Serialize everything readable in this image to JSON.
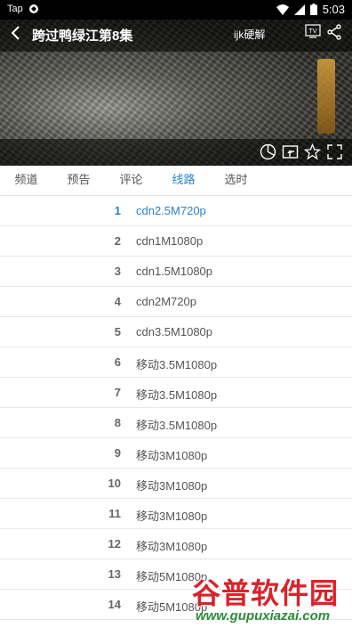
{
  "status_bar": {
    "carrier": "Tap",
    "time": "5:03"
  },
  "player": {
    "title": "跨过鸭绿江第8集",
    "decode_label": "ijk硬解",
    "tv_label": "TV"
  },
  "tabs": [
    {
      "label": "频道",
      "active": false
    },
    {
      "label": "预告",
      "active": false
    },
    {
      "label": "评论",
      "active": false
    },
    {
      "label": "线路",
      "active": true
    },
    {
      "label": "选时",
      "active": false
    }
  ],
  "routes": [
    {
      "index": "1",
      "name": "cdn2.5M720p",
      "selected": true
    },
    {
      "index": "2",
      "name": "cdn1M1080p"
    },
    {
      "index": "3",
      "name": "cdn1.5M1080p"
    },
    {
      "index": "4",
      "name": "cdn2M720p"
    },
    {
      "index": "5",
      "name": "cdn3.5M1080p"
    },
    {
      "index": "6",
      "name": "移动3.5M1080p"
    },
    {
      "index": "7",
      "name": "移动3.5M1080p"
    },
    {
      "index": "8",
      "name": "移动3.5M1080p"
    },
    {
      "index": "9",
      "name": "移动3M1080p"
    },
    {
      "index": "10",
      "name": "移动3M1080p"
    },
    {
      "index": "11",
      "name": "移动3M1080p"
    },
    {
      "index": "12",
      "name": "移动3M1080p"
    },
    {
      "index": "13",
      "name": "移动5M1080p"
    },
    {
      "index": "14",
      "name": "移动5M1080p"
    }
  ],
  "watermark": {
    "title": "谷普软件园",
    "url": "www.gupuxiazai.com"
  },
  "colors": {
    "accent": "#2b82c8",
    "watermark_red": "#d9232b",
    "watermark_green": "#2a8c3a"
  }
}
